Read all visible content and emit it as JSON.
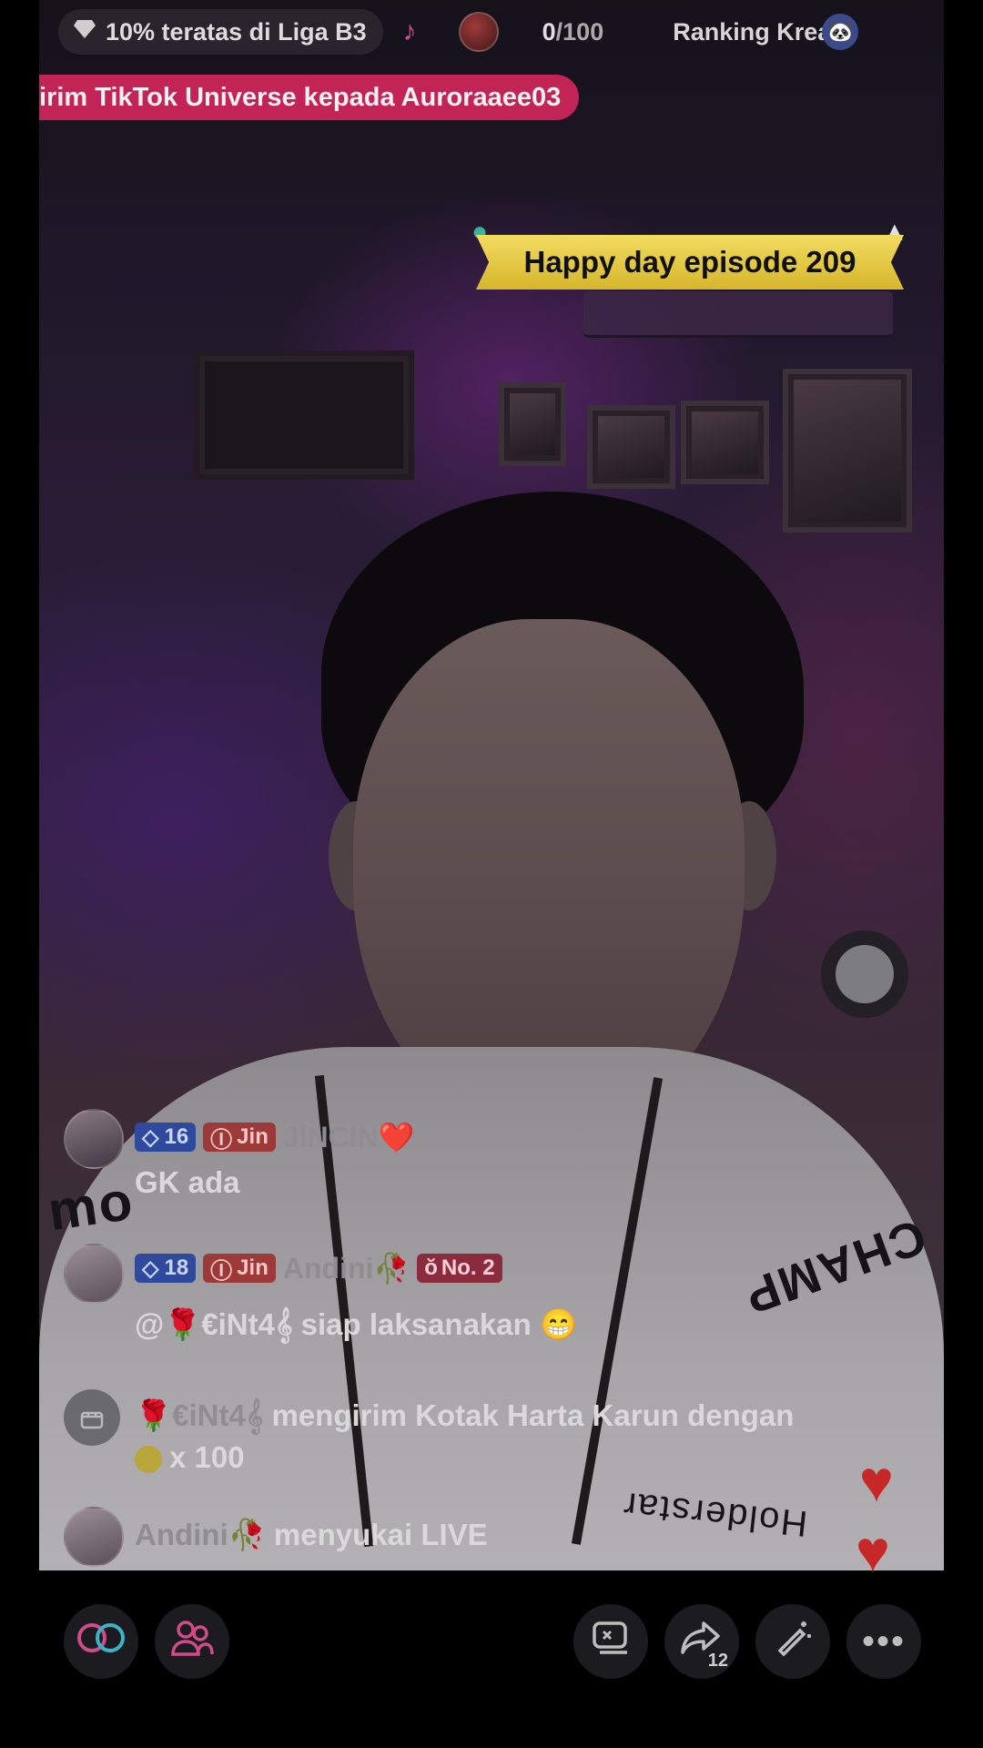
{
  "topbar": {
    "league_text": "10% teratas di Liga B3",
    "score_current": "0",
    "score_total": "/100",
    "ranking_text": "Ranking Krea"
  },
  "gift_banner": {
    "text": "irim TikTok Universe kepada Auroraaee03"
  },
  "episode_banner": {
    "text": "Happy day episode 209"
  },
  "shirt_texts": {
    "left": "mo",
    "right": "CHAMP",
    "brand": "Holderstar"
  },
  "chat": [
    {
      "level": "16",
      "fan_badge": "Jin",
      "username": "JINCIN❤️",
      "message": "GK ada"
    },
    {
      "level": "18",
      "fan_badge": "Jin",
      "username": "Andini🥀",
      "rank_badge": "No. 2",
      "message": "@🌹€iNt4𝄞 siap laksanakan 😁"
    }
  ],
  "gift_event": {
    "user": "🌹€iNt4𝄞",
    "text": "mengirim Kotak Harta Karun dengan",
    "amount": "x 100"
  },
  "like_event": {
    "user": "Andini🥀",
    "text": "menyukai LIVE"
  },
  "bottom_bar": {
    "share_count": "12"
  },
  "icons": {
    "league": "diamond-icon",
    "music": "music-note-icon",
    "mascot": "mascot-icon",
    "gift_box": "gift-box-icon",
    "link": "link-icon",
    "guests": "guests-icon",
    "pip": "picture-in-picture-icon",
    "share": "share-icon",
    "magic": "magic-wand-icon",
    "more": "more-icon",
    "heart": "heart-icon"
  },
  "colors": {
    "gift_banner": "#e1285f",
    "episode_banner": "#f2dc60",
    "level_badge": "#2f4a9c",
    "fan_badge": "#9c3a3a",
    "heart": "#c62828"
  }
}
